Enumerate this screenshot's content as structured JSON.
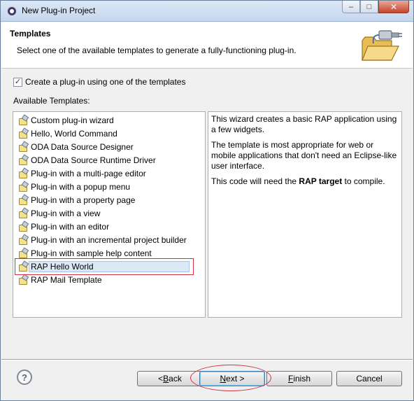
{
  "window": {
    "title": "New Plug-in Project",
    "minimize_glyph": "–",
    "maximize_glyph": "□",
    "close_glyph": "✕"
  },
  "header": {
    "title": "Templates",
    "description": "Select one of the available templates to generate a fully-functioning plug-in."
  },
  "checkbox": {
    "checked": true,
    "glyph": "✓",
    "label": "Create a plug-in using one of the templates"
  },
  "available_label": "Available Templates:",
  "templates": [
    {
      "label": "Custom plug-in wizard"
    },
    {
      "label": "Hello, World Command"
    },
    {
      "label": "ODA Data Source Designer"
    },
    {
      "label": "ODA Data Source Runtime Driver"
    },
    {
      "label": "Plug-in with a multi-page editor"
    },
    {
      "label": "Plug-in with a popup menu"
    },
    {
      "label": "Plug-in with a property page"
    },
    {
      "label": "Plug-in with a view"
    },
    {
      "label": "Plug-in with an editor"
    },
    {
      "label": "Plug-in with an incremental project builder"
    },
    {
      "label": "Plug-in with sample help content"
    },
    {
      "label": "RAP Hello World",
      "selected": true
    },
    {
      "label": "RAP Mail Template"
    }
  ],
  "description": {
    "p1": "This wizard creates a basic RAP application using a few widgets.",
    "p2": "The template is most appropriate for web or mobile applications that don't need an Eclipse-like user interface.",
    "p3_before": "This code will need the ",
    "p3_bold": "RAP target",
    "p3_after": " to compile."
  },
  "footer": {
    "help_glyph": "?",
    "back_prefix": "< ",
    "back_key": "B",
    "back_rest": "ack",
    "next_key": "N",
    "next_rest": "ext >",
    "finish_key": "F",
    "finish_rest": "inish",
    "cancel": "Cancel"
  },
  "colors": {
    "annotation_red": "#d2313f",
    "selection": "#dbe9f7"
  }
}
